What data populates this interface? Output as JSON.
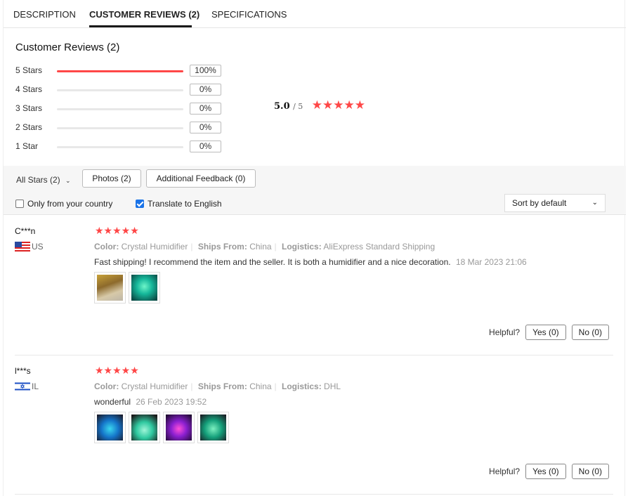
{
  "tabs": [
    {
      "label": "DESCRIPTION",
      "active": false
    },
    {
      "label": "CUSTOMER REVIEWS (2)",
      "active": true
    },
    {
      "label": "SPECIFICATIONS",
      "active": false
    }
  ],
  "summary": {
    "title": "Customer Reviews (2)",
    "rows": [
      {
        "label": "5 Stars",
        "pct": "100%",
        "fraction": 1.0
      },
      {
        "label": "4 Stars",
        "pct": "0%",
        "fraction": 0
      },
      {
        "label": "3 Stars",
        "pct": "0%",
        "fraction": 0
      },
      {
        "label": "2 Stars",
        "pct": "0%",
        "fraction": 0
      },
      {
        "label": "1 Star",
        "pct": "0%",
        "fraction": 0
      }
    ],
    "average": "5.0",
    "out_of": "/ 5",
    "stars": "★★★★★"
  },
  "filters": {
    "all_stars": "All Stars (2)",
    "photos": "Photos (2)",
    "additional": "Additional Feedback (0)",
    "only_country": "Only from your country",
    "translate": "Translate to English",
    "sort": "Sort by default"
  },
  "reviews": [
    {
      "user": "C***n",
      "country": "US",
      "stars": "★★★★★",
      "color_label": "Color:",
      "color": "Crystal Humidifier",
      "ships_label": "Ships From:",
      "ships": "China",
      "logistics_label": "Logistics:",
      "logistics": "AliExpress Standard Shipping",
      "text": "Fast shipping! I recommend the item and the seller. It is both a humidifier and a nice decoration.",
      "date": "18 Mar 2023 21:06",
      "helpful": "Helpful?",
      "yes": "Yes (0)",
      "no": "No (0)"
    },
    {
      "user": "l***s",
      "country": "IL",
      "stars": "★★★★★",
      "color_label": "Color:",
      "color": "Crystal Humidifier",
      "ships_label": "Ships From:",
      "ships": "China",
      "logistics_label": "Logistics:",
      "logistics": "DHL",
      "text": "wonderful",
      "date": "26 Feb 2023 19:52",
      "helpful": "Helpful?",
      "yes": "Yes (0)",
      "no": "No (0)"
    }
  ],
  "colors": {
    "accent": "#ff4747"
  }
}
